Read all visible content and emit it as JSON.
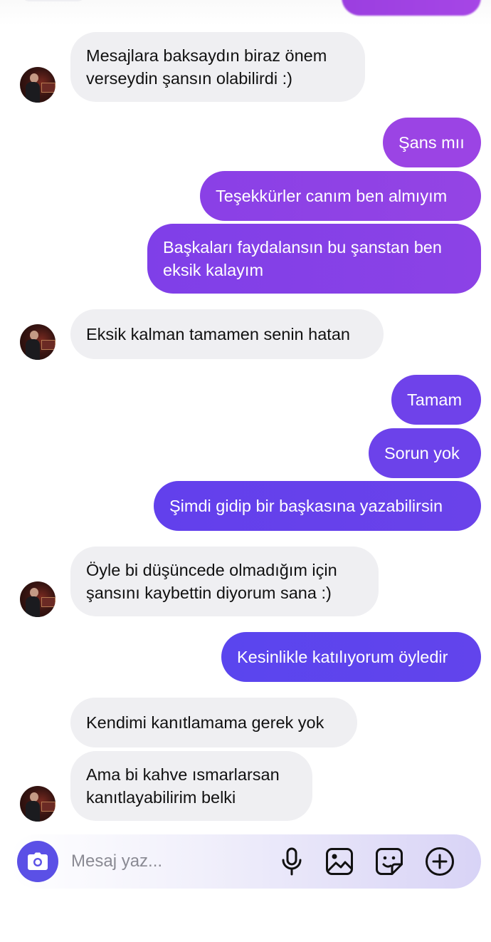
{
  "colors": {
    "incoming_bubble": "#efeff2",
    "outgoing_purple": "#9042e6",
    "outgoing_indigo": "#6243ec",
    "camera_button": "#5b50e6"
  },
  "messages": [
    {
      "direction": "in",
      "lines": [
        "Mesajlara baksaydın biraz önem",
        "verseydin şansın olabilirdi :)"
      ]
    },
    {
      "direction": "out",
      "lines": [
        "Şans mıı"
      ]
    },
    {
      "direction": "out",
      "lines": [
        "Teşekkürler canım ben almıyım"
      ]
    },
    {
      "direction": "out",
      "lines": [
        "Başkaları faydalansın bu şanstan ben",
        "eksik kalayım"
      ]
    },
    {
      "direction": "in",
      "lines": [
        "Eksik kalman tamamen senin hatan"
      ]
    },
    {
      "direction": "out",
      "lines": [
        "Tamam"
      ]
    },
    {
      "direction": "out",
      "lines": [
        "Sorun yok"
      ]
    },
    {
      "direction": "out",
      "lines": [
        "Şimdi gidip bir başkasına yazabilirsin"
      ]
    },
    {
      "direction": "in",
      "lines": [
        "Öyle bi düşüncede olmadığım için",
        "şansını kaybettin diyorum sana :)"
      ]
    },
    {
      "direction": "out",
      "lines": [
        "Kesinlikle katılıyorum öyledir"
      ]
    },
    {
      "direction": "in",
      "lines": [
        "Kendimi kanıtlamama gerek yok"
      ]
    },
    {
      "direction": "in",
      "lines": [
        "Ama bi kahve ısmarlarsan",
        "kanıtlayabilirim belki"
      ]
    }
  ],
  "composer": {
    "placeholder": "Mesaj yaz...",
    "icons": [
      "camera-icon",
      "microphone-icon",
      "gallery-icon",
      "sticker-icon",
      "add-icon"
    ]
  }
}
